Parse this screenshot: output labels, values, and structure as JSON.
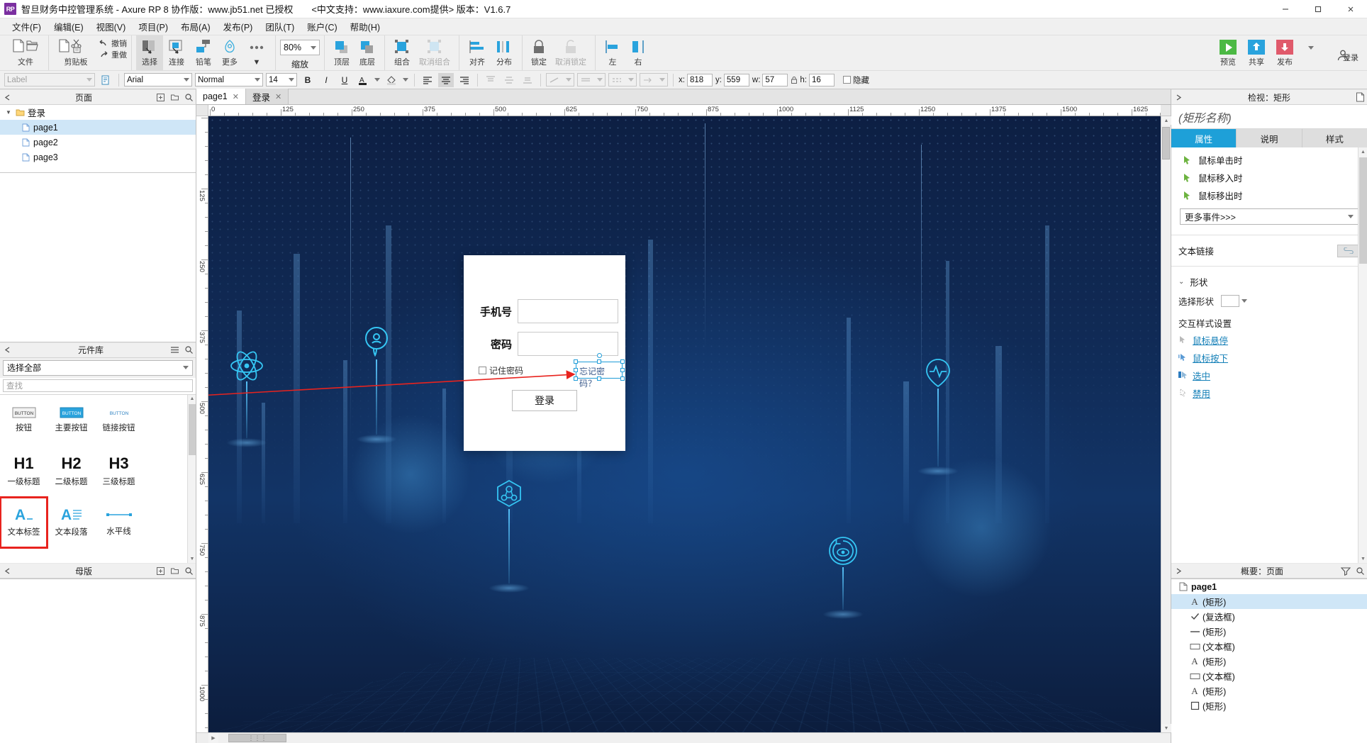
{
  "titlebar": {
    "logo": "RP",
    "title": "智旦财务中控管理系统 - Axure RP 8 协作版：www.jb51.net 已授权",
    "subtitle": "<中文支持：www.iaxure.com提供> 版本：V1.6.7",
    "minimize": "—",
    "maximize": "▢",
    "close": "✕"
  },
  "menu": [
    "文件(F)",
    "编辑(E)",
    "视图(V)",
    "项目(P)",
    "布局(A)",
    "发布(P)",
    "团队(T)",
    "账户(C)",
    "帮助(H)"
  ],
  "toolbar": {
    "file": "文件",
    "clipboard": "剪贴板",
    "undo": "撤销",
    "redo": "重做",
    "select": "选择",
    "connect": "连接",
    "pen": "铅笔",
    "more": "更多",
    "zoom_label": "缩放",
    "zoom_value": "80%",
    "top": "顶层",
    "bottom": "底层",
    "group": "组合",
    "ungroup": "取消组合",
    "align": "对齐",
    "distribute": "分布",
    "lock": "锁定",
    "unlock": "取消锁定",
    "left": "左",
    "right": "右",
    "preview": "预览",
    "share": "共享",
    "publish": "发布",
    "login": "登录"
  },
  "formatbar": {
    "label_placeholder": "Label",
    "font": "Arial",
    "weight": "Normal",
    "size": "14",
    "bold": "B",
    "italic": "I",
    "underline": "U",
    "x_label": "x:",
    "x_value": "818",
    "y_label": "y:",
    "y_value": "559",
    "w_label": "w:",
    "w_value": "57",
    "h_label": "h:",
    "h_value": "16",
    "hide_label": "隐藏"
  },
  "pages_panel": {
    "title": "页面",
    "items": [
      {
        "label": "登录",
        "type": "folder",
        "indent": 0,
        "selected": false
      },
      {
        "label": "page1",
        "type": "page",
        "indent": 1,
        "selected": true
      },
      {
        "label": "page2",
        "type": "page",
        "indent": 1,
        "selected": false
      },
      {
        "label": "page3",
        "type": "page",
        "indent": 1,
        "selected": false
      }
    ]
  },
  "library_panel": {
    "title": "元件库",
    "select_all": "选择全部",
    "search_placeholder": "查找",
    "items": [
      {
        "label": "按钮",
        "glyph": "BUTTON",
        "style": "plain",
        "selected": false
      },
      {
        "label": "主要按钮",
        "glyph": "BUTTON",
        "style": "primary",
        "selected": false
      },
      {
        "label": "链接按钮",
        "glyph": "BUTTON",
        "style": "link",
        "selected": false
      },
      {
        "label": "一级标题",
        "glyph": "H1",
        "style": "h",
        "selected": false
      },
      {
        "label": "二级标题",
        "glyph": "H2",
        "style": "h",
        "selected": false
      },
      {
        "label": "三级标题",
        "glyph": "H3",
        "style": "h",
        "selected": false
      },
      {
        "label": "文本标签",
        "glyph": "A",
        "style": "label",
        "selected": true
      },
      {
        "label": "文本段落",
        "glyph": "A",
        "style": "para",
        "selected": false
      },
      {
        "label": "水平线",
        "glyph": "line",
        "style": "hline",
        "selected": false
      }
    ]
  },
  "masters_panel": {
    "title": "母版"
  },
  "tabs": [
    {
      "label": "page1",
      "active": true,
      "close": "✕"
    },
    {
      "label": "登录",
      "active": false,
      "close": "✕"
    }
  ],
  "rulers": {
    "h_ticks": [
      125,
      250,
      375,
      500,
      625,
      750,
      875,
      1000,
      1125,
      1250,
      1375,
      1500,
      1625
    ],
    "v_ticks": [
      125,
      250,
      375,
      500,
      625,
      750,
      875,
      1000
    ],
    "origin": "0"
  },
  "canvas": {
    "login_card": {
      "phone_label": "手机号",
      "phone_value": "",
      "password_label": "密码",
      "password_value": "",
      "remember_label": "记住密码",
      "forgot_label": "忘记密码？",
      "login_button": "登录"
    }
  },
  "inspector": {
    "title": "检视：矩形",
    "name_placeholder": "(矩形名称)",
    "tabs": [
      {
        "label": "属性",
        "active": true
      },
      {
        "label": "说明",
        "active": false
      },
      {
        "label": "样式",
        "active": false
      }
    ],
    "events": [
      "鼠标单击时",
      "鼠标移入时",
      "鼠标移出时"
    ],
    "more_events": "更多事件>>>",
    "text_link": "文本链接",
    "shape_section": "形状",
    "shape_select_label": "选择形状",
    "interaction_section": "交互样式设置",
    "interaction_links": [
      "鼠标悬停",
      "鼠标按下",
      "选中",
      "禁用"
    ]
  },
  "outline": {
    "title": "概要：页面",
    "root": "page1",
    "items": [
      {
        "label": "(矩形)",
        "icon": "A",
        "selected": true
      },
      {
        "label": "(复选框)",
        "icon": "check",
        "selected": false
      },
      {
        "label": "(矩形)",
        "icon": "hline",
        "selected": false
      },
      {
        "label": "(文本框)",
        "icon": "box",
        "selected": false
      },
      {
        "label": "(矩形)",
        "icon": "A",
        "selected": false
      },
      {
        "label": "(文本框)",
        "icon": "box",
        "selected": false
      },
      {
        "label": "(矩形)",
        "icon": "A",
        "selected": false
      },
      {
        "label": "(矩形)",
        "icon": "square",
        "selected": false
      }
    ]
  },
  "colors": {
    "accent": "#1ea0d8",
    "canvas_bg": "#11284f",
    "cyan": "#35c6f4",
    "annotation_red": "#e8231e",
    "selection": "#cfe6f7"
  }
}
